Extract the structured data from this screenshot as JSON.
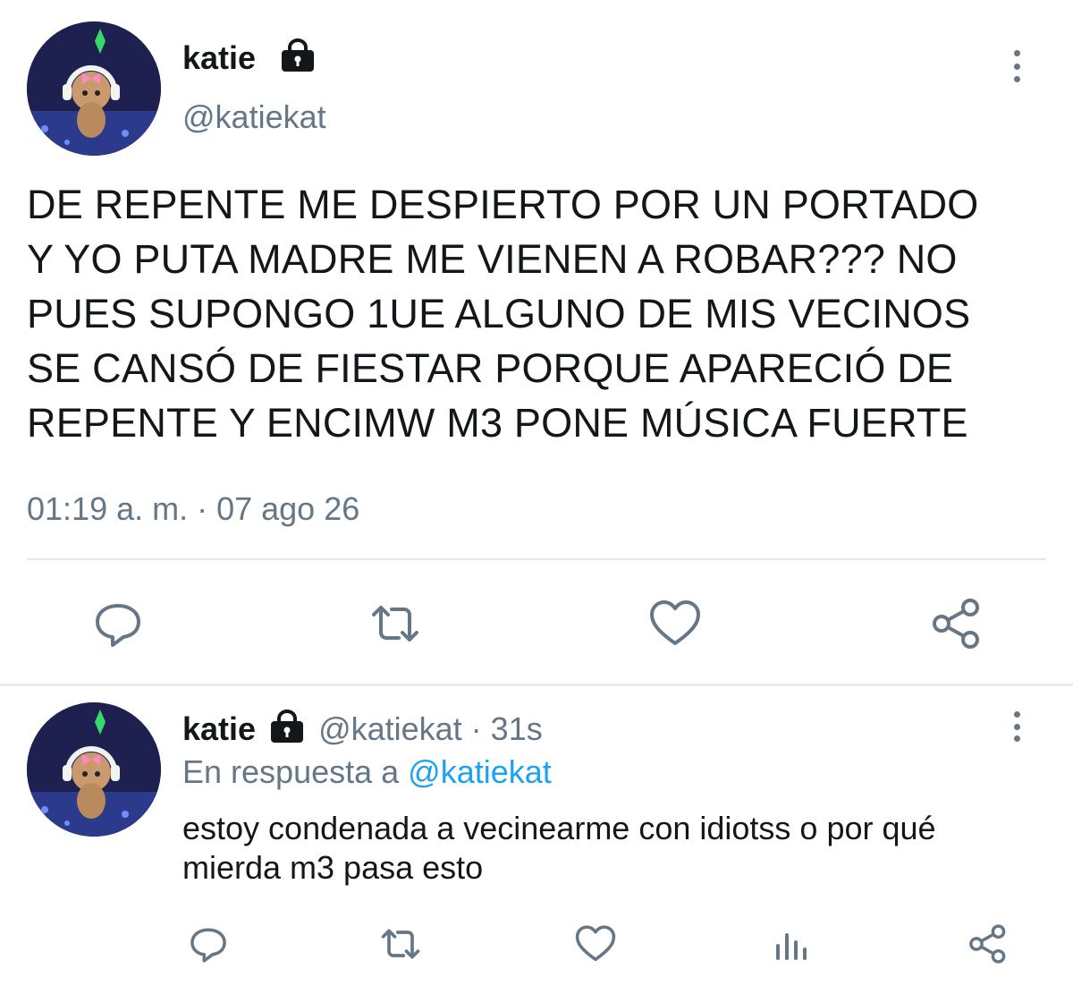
{
  "main_tweet": {
    "display_name": "katie",
    "handle": "@katiekat",
    "lines": [
      "DE REPENTE ME DESPIERTO POR UN PORTADO",
      "Y YO PUTA MADRE ME VIENEN A ROBAR??? NO",
      "PUES SUPONGO 1UE ALGUNO DE MIS VECINOS",
      "SE CANSÓ DE FIESTAR PORQUE APARECIÓ DE",
      "REPENTE Y ENCIMW M3 PONE MÚSICA FUERTE"
    ],
    "timestamp": "01:19 a. m. · 07 ago 26"
  },
  "reply_tweet": {
    "display_name": "katie",
    "handle_time": "@katiekat · 31s",
    "in_reply_prefix": "En respuesta a ",
    "in_reply_handle": "@katiekat",
    "lines": [
      "estoy condenada a vecinearme con idiotss o por qué",
      "mierda m3 pasa esto"
    ]
  },
  "icons": {
    "lock": "lock-icon",
    "more": "more-vertical-icon",
    "reply": "reply-icon",
    "retweet": "retweet-icon",
    "like": "heart-icon",
    "analytics": "analytics-icon",
    "share": "share-icon"
  },
  "colors": {
    "text": "#14171a",
    "secondary": "#657786",
    "link": "#1da1f2",
    "divider": "#e1e8ed"
  }
}
